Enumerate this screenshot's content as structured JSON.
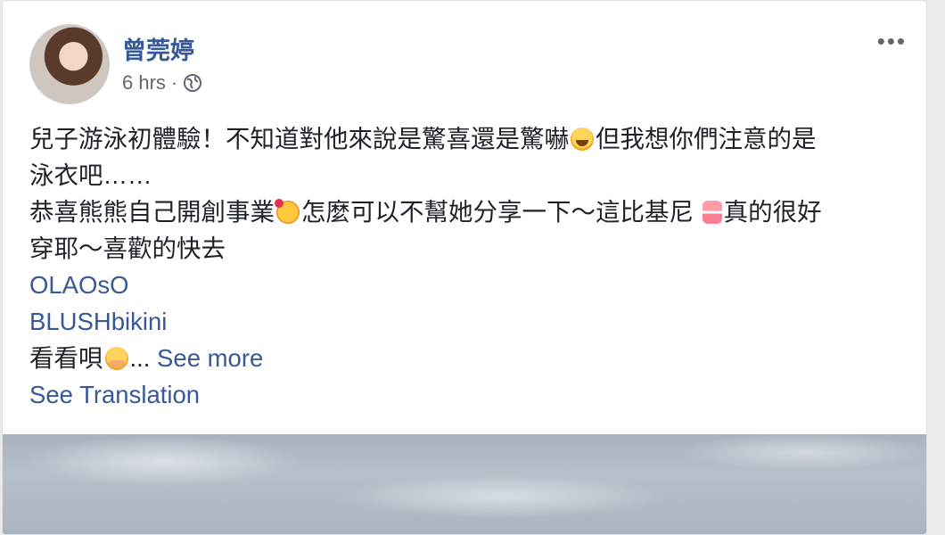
{
  "post": {
    "author": "曾莞婷",
    "time": "6 hrs",
    "separator": "·",
    "more_label": "•••",
    "lines": [
      {
        "a": "兒子游泳初體驗！不知道對他來說是驚喜還是驚嚇",
        "emoji": "face-with-tears-of-joy-icon",
        "b": "但我想你們注意的是"
      },
      {
        "a": "泳衣吧……"
      },
      {
        "a": "恭喜熊熊自己開創事業",
        "emoji": "smiling-face-with-hearts-icon",
        "b": "怎麼可以不幫她分享一下～這比基尼 ",
        "emoji2": "bikini-icon",
        "c": "真的很好"
      },
      {
        "a": "穿耶～喜歡的快去"
      }
    ],
    "links": [
      "OLAOsO",
      "BLUSHbikini"
    ],
    "last_line": {
      "a": "看看唄",
      "emoji": "hugging-face-icon",
      "ellipsis": "...",
      "see_more": " See more"
    },
    "see_translation": "See Translation"
  },
  "colors": {
    "link": "#385898",
    "text": "#1d2129",
    "meta": "#616770"
  }
}
